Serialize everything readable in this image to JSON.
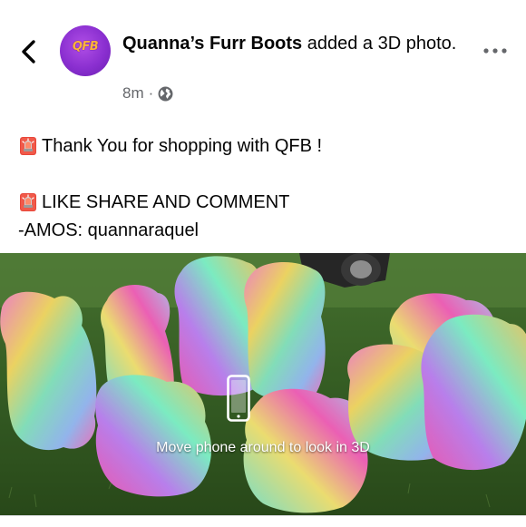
{
  "post": {
    "page_name": "Quanna’s Furr Boots",
    "action_text": " added a 3D photo.",
    "time_ago": "8m",
    "separator": "·",
    "privacy_icon": "globe-icon",
    "avatar_logo_text": "QFB",
    "text_line_1": "Thank You for shopping with QFB !",
    "text_line_2": "LIKE SHARE AND COMMENT",
    "text_line_3": "-AMOS: quannaraquel",
    "emoji_icon": "siren-emoji-icon"
  },
  "photo": {
    "hint": "Move phone around to look in 3D",
    "hint_icon": "phone-icon"
  },
  "nav": {
    "back_icon": "chevron-left-icon",
    "more_icon": "more-horizontal-icon"
  },
  "colors": {
    "text_primary": "#050505",
    "text_secondary": "#65676b",
    "avatar_purple": "#8a2fd0",
    "avatar_logo": "#ffb43a",
    "grass": "#3f6b2a"
  }
}
